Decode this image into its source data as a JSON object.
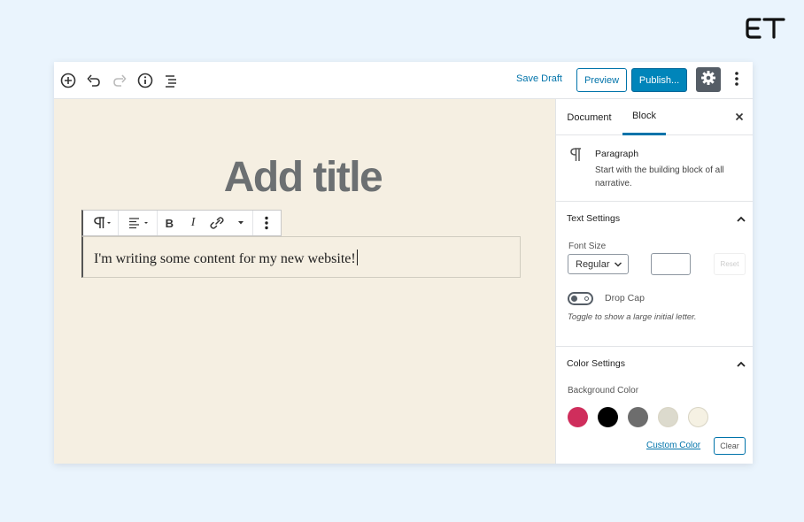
{
  "brand": {
    "logo_text": "ET"
  },
  "toolbar": {
    "icons": [
      "add-block-icon",
      "undo-icon",
      "redo-icon",
      "info-icon",
      "block-navigation-icon"
    ],
    "save_draft": "Save Draft",
    "preview": "Preview",
    "publish": "Publish...",
    "settings_icon": "gear-icon",
    "more_icon": "more-vertical-icon"
  },
  "editor": {
    "title_placeholder": "Add title",
    "paragraph_text": "I'm writing some content for my new website!",
    "block_toolbar": [
      "paragraph-icon",
      "align-icon",
      "bold-icon",
      "italic-icon",
      "link-icon",
      "more-rich-text-icon",
      "more-options-icon"
    ],
    "bold_label": "B",
    "italic_label": "I"
  },
  "sidebar": {
    "tabs": [
      {
        "label": "Document",
        "active": false
      },
      {
        "label": "Block",
        "active": true
      }
    ],
    "block_card": {
      "icon": "paragraph-icon",
      "title": "Paragraph",
      "description": "Start with the building block of all narrative."
    },
    "text_settings": {
      "heading": "Text Settings",
      "font_size_label": "Font Size",
      "font_size_value": "Regular",
      "custom_size_value": "",
      "reset_label": "Reset",
      "drop_cap_label": "Drop Cap",
      "drop_cap_enabled": false,
      "drop_cap_help": "Toggle to show a large initial letter."
    },
    "color_settings": {
      "heading": "Color Settings",
      "background_label": "Background Color",
      "swatches": [
        "#cf2e5c",
        "#000000",
        "#6d6d6d",
        "#dcdacd",
        "#f5f1e3"
      ],
      "custom_color": "Custom Color",
      "clear": "Clear"
    }
  },
  "colors": {
    "accent": "#0073aa",
    "publish": "#0085ba",
    "editor_background": "#f5efe2",
    "page_background": "#eaf4fd"
  }
}
